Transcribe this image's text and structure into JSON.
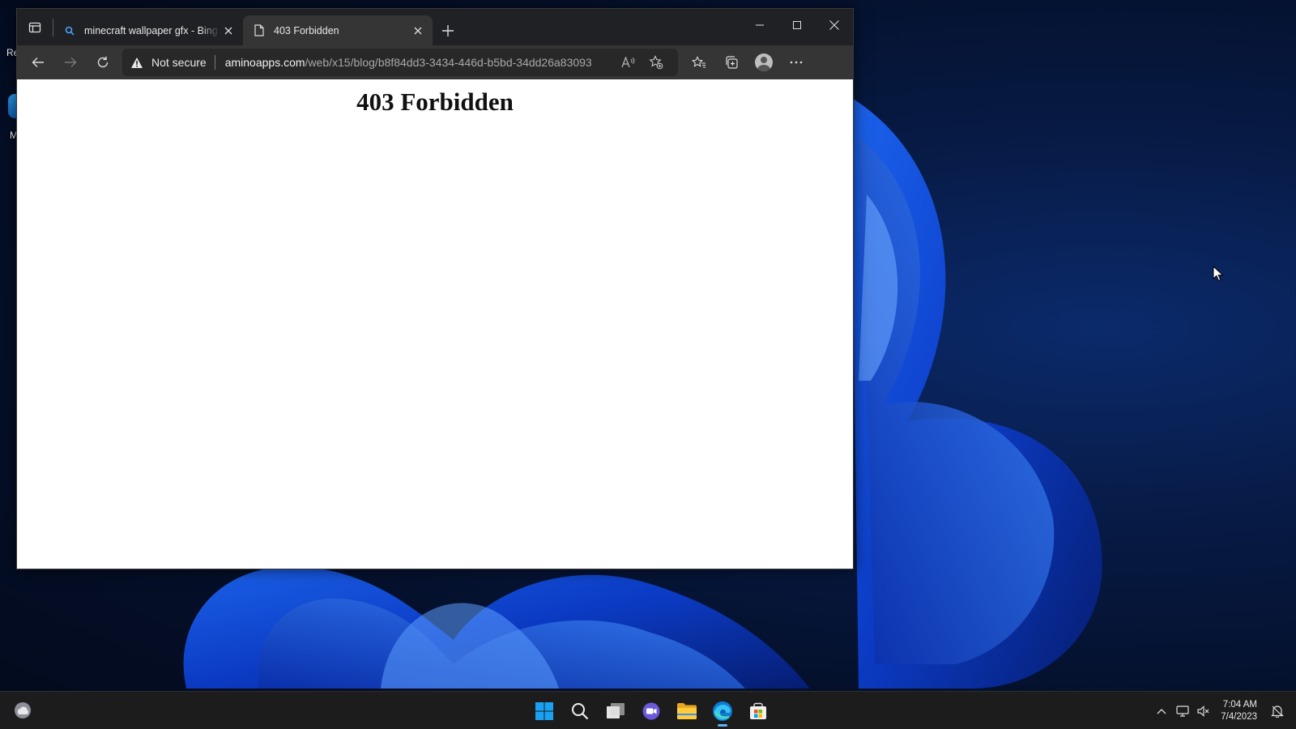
{
  "desktop": {
    "icon_label_top": "Re",
    "icon_label_bottom": "M"
  },
  "browser": {
    "tabs": [
      {
        "title": "minecraft wallpaper gfx - Bing images",
        "active": false,
        "favicon": "search-icon"
      },
      {
        "title": "403 Forbidden",
        "active": true,
        "favicon": "page-icon"
      }
    ],
    "address": {
      "security_label": "Not secure",
      "host": "aminoapps.com",
      "path": "/web/x15/blog/b8f84dd3-3434-446d-b5bd-34dd26a83093"
    },
    "page": {
      "heading": "403 Forbidden"
    }
  },
  "taskbar": {
    "apps": [
      "start-icon",
      "search-icon",
      "task-view-icon",
      "chat-icon",
      "file-explorer-icon",
      "edge-icon",
      "store-icon"
    ],
    "time": "7:04 AM",
    "date": "7/4/2023"
  },
  "colors": {
    "accent": "#5fb2f2",
    "desktop_bg": "#040f28",
    "titlebar": "#202124",
    "toolbar": "#353535"
  }
}
